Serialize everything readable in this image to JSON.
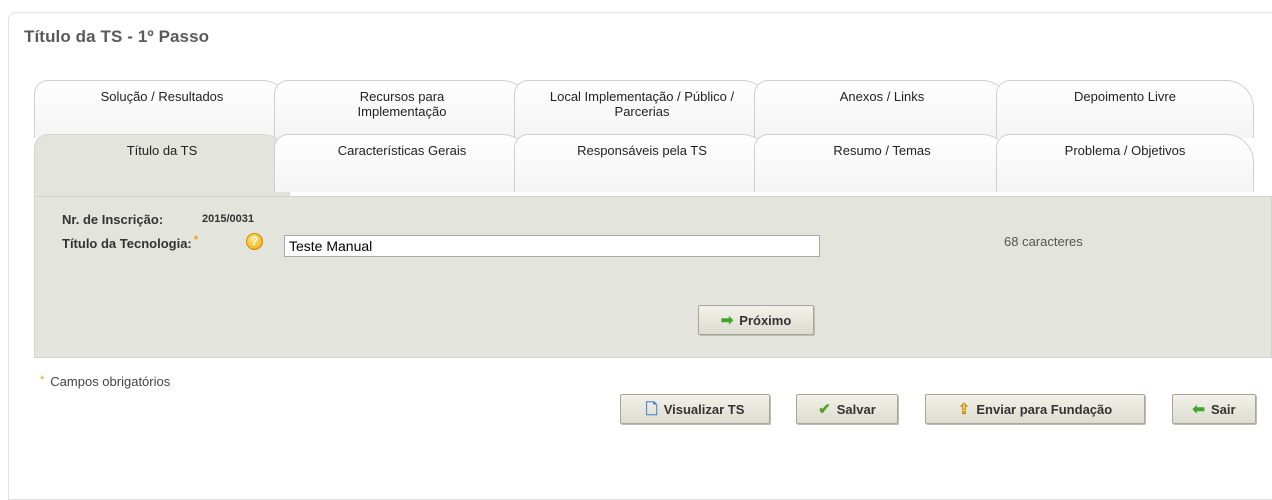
{
  "page": {
    "title": "Título da TS - 1º Passo"
  },
  "tabs": {
    "row1": [
      {
        "label": "Solução / Resultados"
      },
      {
        "label": "Recursos para Implementação"
      },
      {
        "label": "Local Implementação / Público / Parcerias"
      },
      {
        "label": "Anexos / Links"
      },
      {
        "label": "Depoimento Livre"
      }
    ],
    "row2": [
      {
        "label": "Título da TS",
        "active": true
      },
      {
        "label": "Características Gerais"
      },
      {
        "label": "Responsáveis pela TS"
      },
      {
        "label": "Resumo / Temas"
      },
      {
        "label": "Problema / Objetivos"
      }
    ]
  },
  "form": {
    "inscricao_label": "Nr. de Inscrição:",
    "inscricao_value": "2015/0031",
    "titulo_label": "Título da Tecnologia:",
    "required_marker": "*",
    "help_icon": "question-icon",
    "titulo_value": "Teste Manual",
    "char_count": "68 caracteres",
    "next_label": "Próximo"
  },
  "footer": {
    "required_note": "Campos obrigatórios",
    "buttons": {
      "visualizar": "Visualizar TS",
      "salvar": "Salvar",
      "enviar": "Enviar para Fundação",
      "sair": "Sair"
    }
  },
  "colors": {
    "content_bg": "#e3e4dc",
    "required_star": "#f39c12",
    "arrow_green": "#3fa52b"
  }
}
